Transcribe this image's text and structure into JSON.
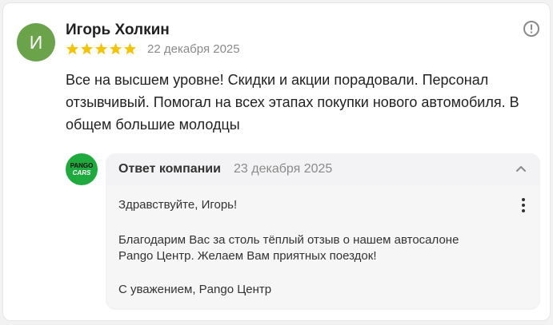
{
  "review": {
    "author_initial": "И",
    "author_name": "Игорь Холкин",
    "rating": 5,
    "date": "22 декабря 2025",
    "text": "Все на высшем уровне! Скидки и акции порадовали. Персонал отзывчивый. Помогал на всех этапах покупки нового автомобиля. В общем большие молодцы",
    "avatar_color": "#6ba34a",
    "star_color": "#f5c400"
  },
  "company": {
    "logo_top": "PANGO",
    "logo_bottom": "CARS",
    "logo_color": "#1faa3e"
  },
  "reply": {
    "title": "Ответ компании",
    "date": "23 декабря 2025",
    "greeting": "Здравствуйте, Игорь!",
    "body_line1": "Благодарим Вас за столь тёплый отзыв о нашем автосалоне",
    "body_line2": "Pango Центр. Желаем Вам приятных поездок!",
    "signature": "С уважением, Pango Центр"
  },
  "icons": {
    "info": "info-icon",
    "collapse": "chevron-up-icon",
    "more": "more-vertical-icon",
    "star": "star-icon"
  }
}
